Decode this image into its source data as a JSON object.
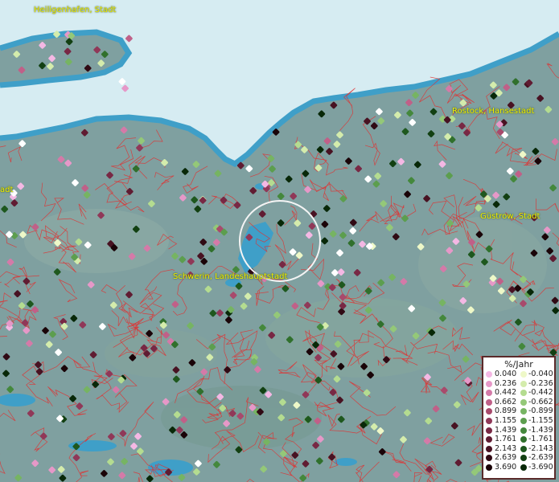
{
  "map": {
    "cities": [
      {
        "name": "Heiligenhafen, Stadt"
      },
      {
        "name": "Rostock, Hansestadt"
      },
      {
        "name": "Güstrow, Stadt"
      },
      {
        "name": "Schwerin, Landeshauptstadt"
      },
      {
        "name": "adt"
      }
    ],
    "colors": {
      "water": "#d6ecf2",
      "coast": "#3f9fc8",
      "land": "#7fa0a0",
      "borders": "#e03030"
    }
  },
  "legend": {
    "title": "%/Jahr",
    "positive": [
      {
        "value": "0.040",
        "color": "#f4b8e4"
      },
      {
        "value": "0.236",
        "color": "#e698c8"
      },
      {
        "value": "0.442",
        "color": "#d47aa8"
      },
      {
        "value": "0.662",
        "color": "#c06088"
      },
      {
        "value": "0.899",
        "color": "#a84a6c"
      },
      {
        "value": "1.155",
        "color": "#903858"
      },
      {
        "value": "1.439",
        "color": "#782844"
      },
      {
        "value": "1.761",
        "color": "#601c32"
      },
      {
        "value": "2.143",
        "color": "#481222"
      },
      {
        "value": "2.639",
        "color": "#300a14"
      },
      {
        "value": "3.690",
        "color": "#1a0408"
      }
    ],
    "negative": [
      {
        "value": "-0.040",
        "color": "#eef8c8"
      },
      {
        "value": "-0.236",
        "color": "#d4ecac"
      },
      {
        "value": "-0.442",
        "color": "#b4dc90"
      },
      {
        "value": "-0.662",
        "color": "#94c878"
      },
      {
        "value": "-0.899",
        "color": "#76b462"
      },
      {
        "value": "-1.155",
        "color": "#5c9e4e"
      },
      {
        "value": "-1.439",
        "color": "#44883c"
      },
      {
        "value": "-1.761",
        "color": "#30702c"
      },
      {
        "value": "-2.143",
        "color": "#1e581e"
      },
      {
        "value": "-2.639",
        "color": "#124012"
      },
      {
        "value": "-3.690",
        "color": "#082808"
      }
    ]
  }
}
